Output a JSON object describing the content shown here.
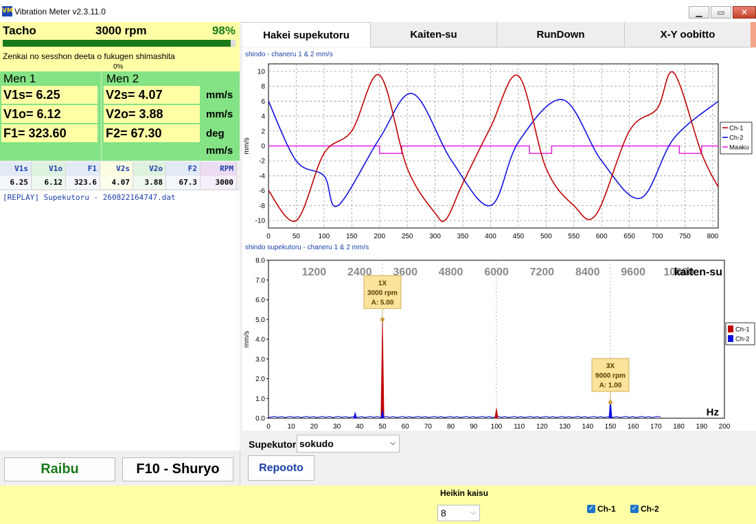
{
  "window": {
    "title": "Vibration Meter v2.3.11.0",
    "logo_text": "VM"
  },
  "tacho": {
    "label": "Tacho",
    "rpm": "3000 rpm",
    "percent": "98%",
    "progress": 0.98,
    "message": "Zenkai no sesshon deeta o fukugen shimashita",
    "small_percent": "0%"
  },
  "plane1": {
    "title": "Men 1",
    "v1s": "V1s= 6.25",
    "v1o": "V1o= 6.12",
    "f1": "F1= 323.60"
  },
  "plane2": {
    "title": "Men 2",
    "v2s": "V2s= 4.07",
    "v2o": "V2o= 3.88",
    "f2": "F2= 67.30"
  },
  "units": [
    "mm/s",
    "mm/s",
    "deg",
    "mm/s"
  ],
  "table": {
    "headers": [
      "V1s",
      "V1o",
      "F1",
      "V2s",
      "V2o",
      "F2",
      "RPM"
    ],
    "row": [
      "6.25",
      "6.12",
      "323.6",
      "4.07",
      "3.88",
      "67.3",
      "3000"
    ]
  },
  "log": "[REPLAY] Supekutoru - 260822164747.dat",
  "buttons": {
    "live": "Raibu",
    "exit": "F10 - Shuryo",
    "report": "Repooto"
  },
  "tabs": [
    "Hakei supekutoru",
    "Kaiten-su",
    "RunDown",
    "X-Y oobitto"
  ],
  "waveform": {
    "caption": "shindo  - chaneru 1 & 2 mm/s",
    "ylabel": "mm/s",
    "legend": [
      "Ch-1",
      "Ch-2",
      "Maaku"
    ],
    "y_ticks": [
      "10",
      "8",
      "6",
      "4",
      "2",
      "0",
      "-2",
      "-4",
      "-6",
      "-8",
      "-10"
    ],
    "x_ticks": [
      "0",
      "50",
      "100",
      "150",
      "200",
      "250",
      "300",
      "350",
      "400",
      "450",
      "500",
      "550",
      "600",
      "650",
      "700",
      "750",
      "800"
    ]
  },
  "spectrum": {
    "caption": "shindo supekutoru  - chaneru 1 & 2 mm/s",
    "ylabel": "mm/s",
    "xunit": "Hz",
    "top_label": "kaiten-su",
    "rpm_ticks": [
      "1200",
      "2400",
      "3600",
      "4800",
      "6000",
      "7200",
      "8400",
      "9600",
      "10800"
    ],
    "y_ticks": [
      "8.0",
      "7.0",
      "6.0",
      "5.0",
      "4.0",
      "3.0",
      "2.0",
      "1.0",
      "0.0"
    ],
    "x_ticks": [
      "0",
      "10",
      "20",
      "30",
      "40",
      "50",
      "60",
      "70",
      "80",
      "90",
      "100",
      "110",
      "120",
      "130",
      "140",
      "150",
      "160",
      "170",
      "180",
      "190",
      "200"
    ],
    "legend": [
      "Ch-1",
      "Ch-2"
    ],
    "marker1": {
      "l1": "1X",
      "l2": "3000 rpm",
      "l3": "A: 5.00"
    },
    "marker2": {
      "l1": "3X",
      "l2": "9000 rpm",
      "l3": "A: 1.00"
    }
  },
  "spectrum_select": {
    "label": "Supekutoru",
    "value": "sokudo"
  },
  "footer": {
    "average_label": "Heikin kaisu",
    "average_value": "8",
    "ch1": "Ch-1",
    "ch2": "Ch-2"
  },
  "colors": {
    "ch1": "#c00000",
    "ch2": "#1010e0",
    "mark": "#e020e0",
    "accent_yellow": "#ffffa6",
    "panel_green": "#84e384"
  },
  "chart_data": [
    {
      "type": "line",
      "title": "shindo  - chaneru 1 & 2 mm/s",
      "ylabel": "mm/s",
      "xlim": [
        0,
        810
      ],
      "ylim": [
        -11,
        11
      ],
      "series": [
        {
          "name": "Ch-1",
          "x": [
            0,
            50,
            100,
            150,
            200,
            250,
            300,
            320,
            350,
            400,
            450,
            500,
            550,
            590,
            650,
            700,
            730,
            780,
            810
          ],
          "y": [
            -6,
            -10,
            -1,
            2,
            9.5,
            -3,
            -9,
            -9.8,
            -5,
            2.5,
            9.4,
            -3,
            -8,
            -9.2,
            2,
            5,
            9.8,
            -1,
            -5.5
          ]
        },
        {
          "name": "Ch-2",
          "x": [
            0,
            50,
            100,
            125,
            200,
            260,
            330,
            400,
            450,
            530,
            600,
            670,
            730,
            810
          ],
          "y": [
            6,
            -2,
            -4,
            -8,
            1,
            7,
            -2,
            -8,
            0.5,
            6.2,
            -2,
            -7,
            1,
            6
          ]
        },
        {
          "name": "Maaku",
          "x": [
            0,
            200,
            200,
            240,
            240,
            470,
            470,
            510,
            510,
            740,
            740,
            780,
            780,
            810
          ],
          "y": [
            0,
            0,
            -1,
            -1,
            0,
            0,
            -1,
            -1,
            0,
            0,
            -1,
            -1,
            0,
            0
          ]
        }
      ]
    },
    {
      "type": "bar",
      "title": "shindo supekutoru  - chaneru 1 & 2 mm/s",
      "xlabel": "Hz",
      "ylabel": "mm/s",
      "xlim": [
        0,
        200
      ],
      "ylim": [
        0,
        8
      ],
      "series": [
        {
          "name": "Ch-1",
          "x": [
            50,
            100,
            150
          ],
          "y": [
            5.0,
            0.5,
            0.3
          ]
        },
        {
          "name": "Ch-2",
          "x": [
            38,
            50,
            150
          ],
          "y": [
            0.3,
            0.4,
            1.0
          ]
        }
      ]
    }
  ]
}
